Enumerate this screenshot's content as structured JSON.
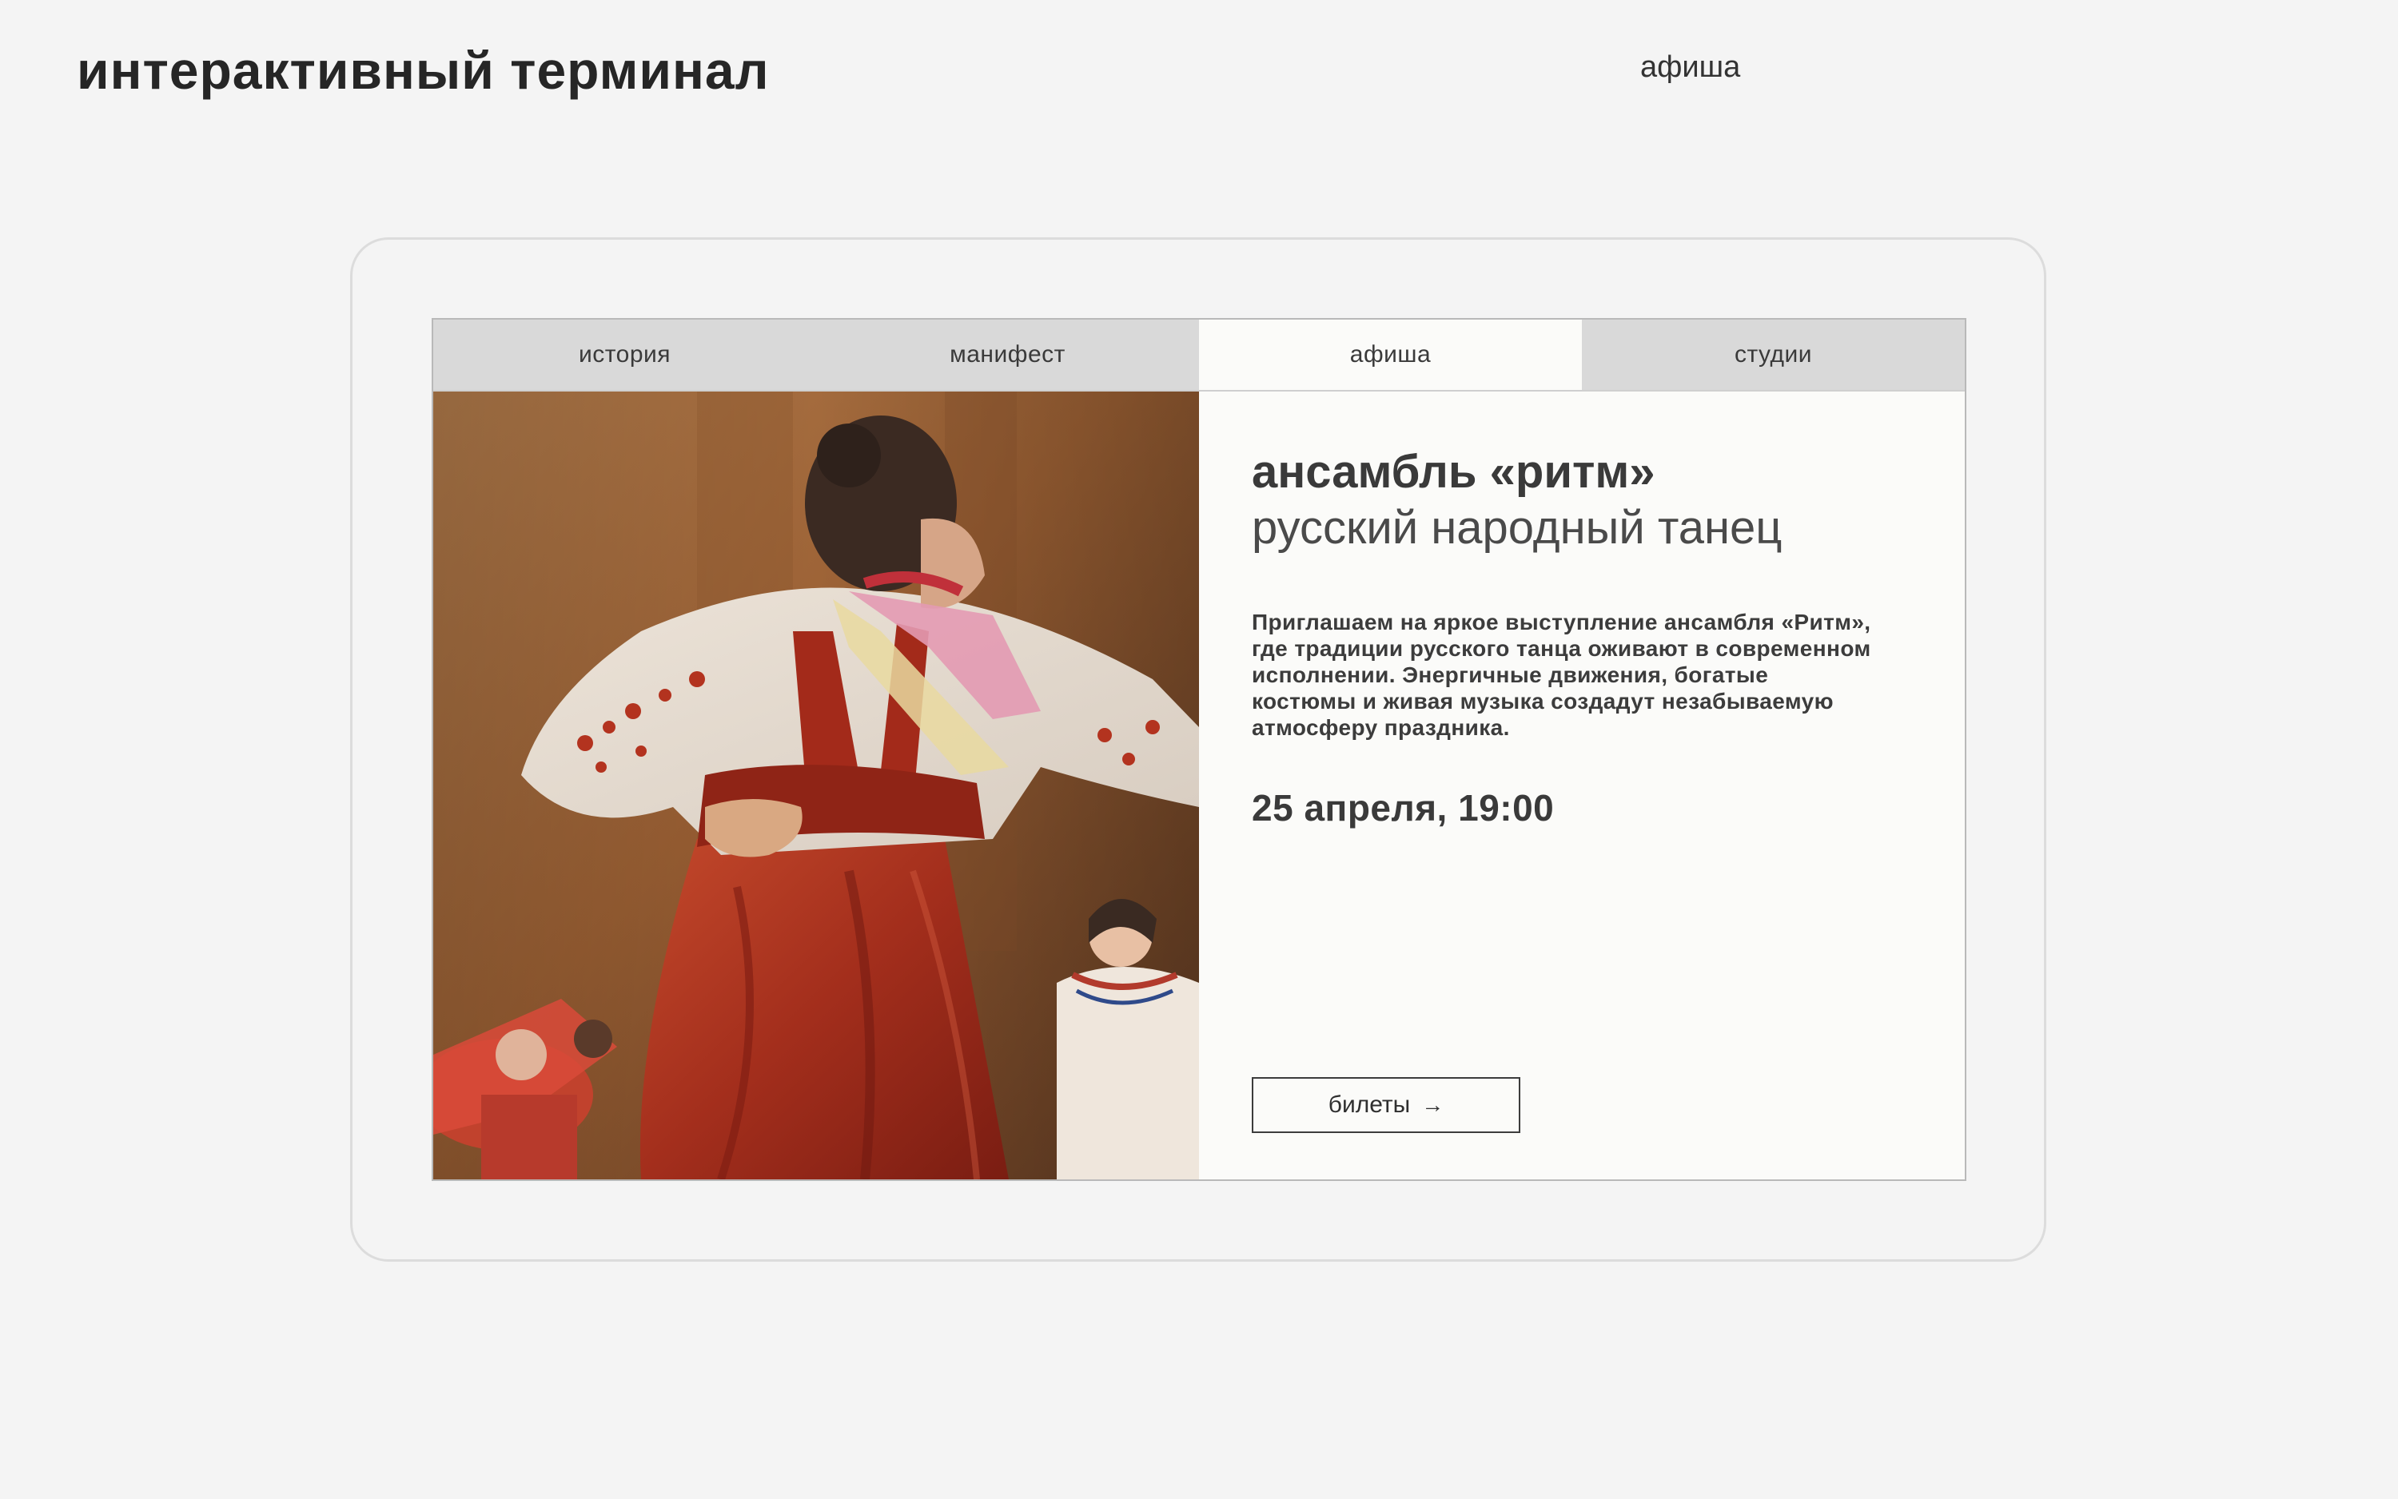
{
  "header": {
    "title": "интерактивный терминал",
    "section": "афиша"
  },
  "screen": {
    "tabs": [
      {
        "label": "история",
        "active": false
      },
      {
        "label": "манифест",
        "active": false
      },
      {
        "label": "афиша",
        "active": true
      },
      {
        "label": "студии",
        "active": false
      }
    ],
    "event": {
      "title": "ансамбль «ритм»",
      "subtitle": "русский народный танец",
      "description": "Приглашаем на яркое выступление ансамбля «Ритм», где традиции русского танца оживают в современном исполнении. Энергичные движения, богатые костюмы и живая музыка создадут незабываемую атмосферу праздника.",
      "date": "25 апреля, 19:00",
      "tickets_label": "билеты",
      "tickets_icon": "arrow-right-icon"
    }
  },
  "colors": {
    "background": "#f4f4f4",
    "tab_inactive": "#d9d9d9",
    "tab_active": "#fbfbf9",
    "text": "#3a3a3a"
  }
}
